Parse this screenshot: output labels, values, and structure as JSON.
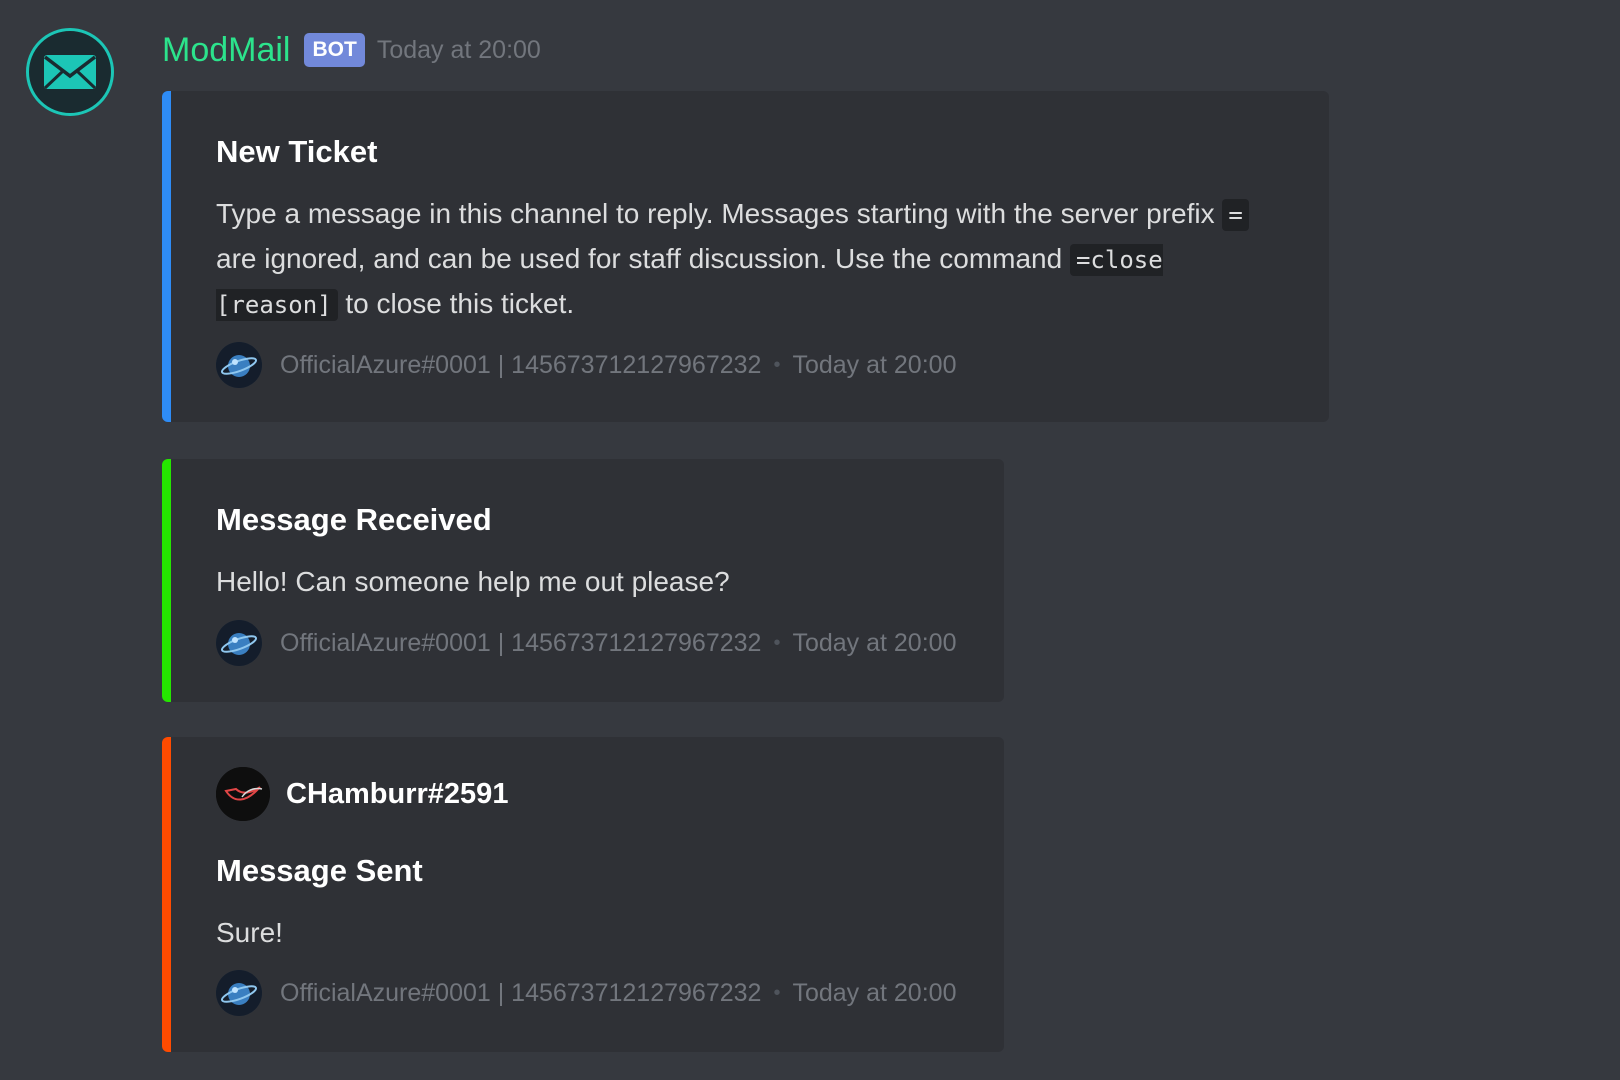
{
  "message": {
    "author": "ModMail",
    "bot_tag": "BOT",
    "timestamp": "Today at 20:00"
  },
  "embeds": [
    {
      "accent_color": "#2e8cf6",
      "title": "New Ticket",
      "description": {
        "text_1": "Type a message in this channel to reply. Messages starting with the server prefix ",
        "code_1": "=",
        "text_2": " are ignored, and can be used for staff discussion. Use the command ",
        "code_2": "=close [reason]",
        "text_3": " to close this ticket."
      },
      "footer": {
        "text": "OfficialAzure#0001 | 145673712127967232",
        "separator": "•",
        "timestamp": "Today at 20:00"
      }
    },
    {
      "accent_color": "#25e600",
      "title": "Message Received",
      "description": "Hello! Can someone help me out please?",
      "footer": {
        "text": "OfficialAzure#0001 | 145673712127967232",
        "separator": "•",
        "timestamp": "Today at 20:00"
      }
    },
    {
      "accent_color": "#ff4b00",
      "author": "CHamburr#2591",
      "title": "Message Sent",
      "description": "Sure!",
      "footer": {
        "text": "OfficialAzure#0001 | 145673712127967232",
        "separator": "•",
        "timestamp": "Today at 20:00"
      }
    }
  ],
  "icons": {
    "bot_avatar": "envelope-icon",
    "footer_avatar": "planet-icon",
    "author_avatar": "bird-icon"
  }
}
